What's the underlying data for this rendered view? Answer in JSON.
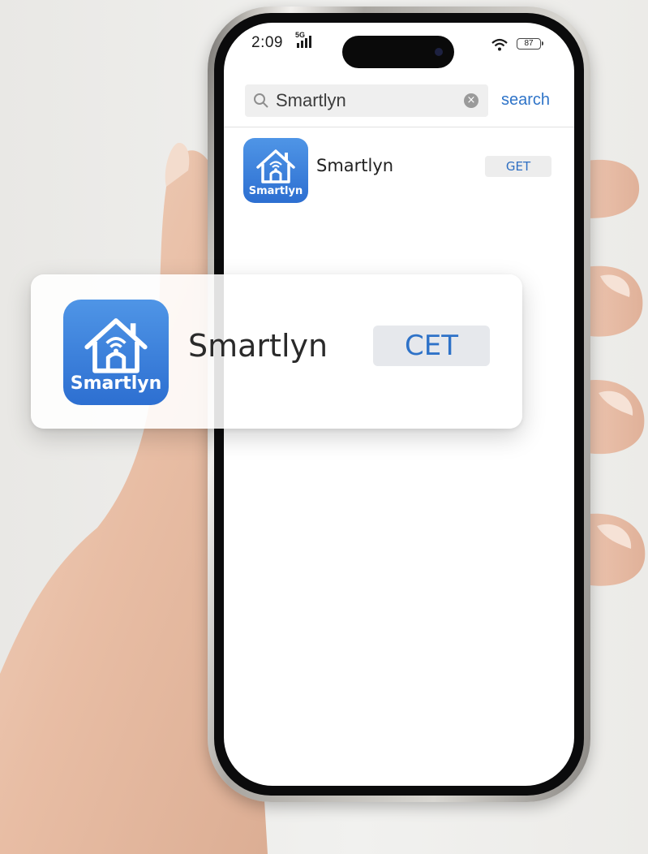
{
  "status_bar": {
    "time": "2:09",
    "network": "5G",
    "battery": "87",
    "icons": [
      "signal-bars-icon",
      "wifi-icon",
      "battery-icon"
    ]
  },
  "search": {
    "query": "Smartlyn",
    "action_label": "search",
    "icons": [
      "search-icon",
      "clear-icon"
    ]
  },
  "results": [
    {
      "app_name": "Smartlyn",
      "icon_label": "Smartlyn",
      "button_label": "GET"
    }
  ],
  "callout": {
    "app_name": "Smartlyn",
    "icon_label": "Smartlyn",
    "button_label": "CET"
  },
  "colors": {
    "accent": "#2f74c8",
    "app_icon_top": "#4f95e6",
    "app_icon_bottom": "#2d6fd1",
    "button_bg": "#ededed"
  }
}
